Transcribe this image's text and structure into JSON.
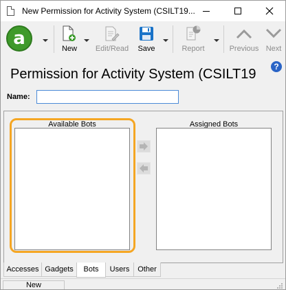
{
  "window": {
    "title": "New Permission for Activity System (CSILT19..."
  },
  "toolbar": {
    "app_logo_letter": "a",
    "new_label": "New",
    "edit_read_label": "Edit/Read",
    "save_label": "Save",
    "report_label": "Report",
    "previous_label": "Previous",
    "next_label": "Next"
  },
  "form": {
    "heading": "Permission for Activity System (CSILT19",
    "help": "?",
    "name_label": "Name:",
    "name_value": ""
  },
  "bots": {
    "available_label": "Available Bots",
    "assigned_label": "Assigned Bots"
  },
  "tabs": [
    {
      "label": "Accesses"
    },
    {
      "label": "Gadgets"
    },
    {
      "label": "Bots"
    },
    {
      "label": "Users"
    },
    {
      "label": "Other"
    }
  ],
  "status": {
    "mode": "New"
  },
  "colors": {
    "logo_green": "#3f9a2b",
    "save_blue": "#1a73c8",
    "highlight_orange": "#f5a623",
    "help_blue": "#2a64c6"
  }
}
